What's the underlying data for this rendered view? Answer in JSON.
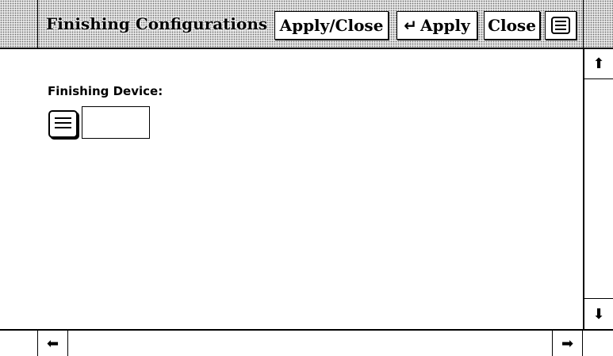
{
  "window": {
    "title": "Finishing Configurations"
  },
  "commands": {
    "apply_close_label": "Apply/Close",
    "apply_label": "Apply",
    "apply_glyph": "↵",
    "close_label": "Close",
    "menu_icon": "menu-icon"
  },
  "form": {
    "finishing_device_label": "Finishing Device:",
    "finishing_device_value": "",
    "device_menu_icon": "menu-icon"
  },
  "scrollbars": {
    "up_arrow": "⬆",
    "down_arrow": "⬇",
    "left_arrow": "⬅",
    "right_arrow": "➡"
  }
}
